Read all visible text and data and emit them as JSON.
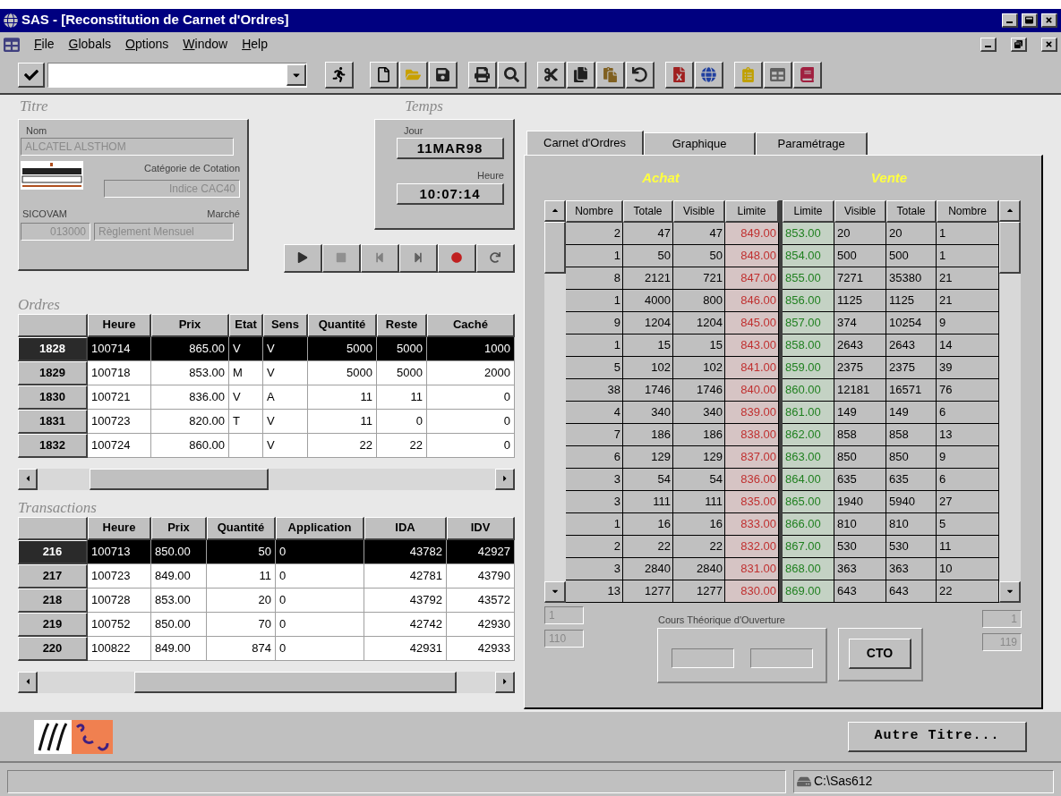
{
  "window": {
    "title": "SAS - [Reconstitution de Carnet d'Ordres]"
  },
  "menu": [
    "File",
    "Globals",
    "Options",
    "Window",
    "Help"
  ],
  "titre": {
    "heading": "Titre",
    "nom_label": "Nom",
    "nom": "ALCATEL ALSTHOM",
    "categorie_label": "Catégorie de Cotation",
    "categorie": "Indice CAC40",
    "sicovam_label": "SICOVAM",
    "sicovam": "013000",
    "marche_label": "Marché",
    "marche": "Règlement Mensuel"
  },
  "temps": {
    "heading": "Temps",
    "jour_label": "Jour",
    "jour": "11MAR98",
    "heure_label": "Heure",
    "heure": "10:07:14"
  },
  "ordres": {
    "heading": "Ordres",
    "columns": [
      "Heure",
      "Prix",
      "Etat",
      "Sens",
      "Quantité",
      "Reste",
      "Caché"
    ],
    "rows": [
      {
        "id": "1828",
        "heure": "100714",
        "prix": "865.00",
        "etat": "V",
        "sens": "V",
        "quantite": "5000",
        "reste": "5000",
        "cache": "1000",
        "selected": true
      },
      {
        "id": "1829",
        "heure": "100718",
        "prix": "853.00",
        "etat": "M",
        "sens": "V",
        "quantite": "5000",
        "reste": "5000",
        "cache": "2000",
        "selected": false
      },
      {
        "id": "1830",
        "heure": "100721",
        "prix": "836.00",
        "etat": "V",
        "sens": "A",
        "quantite": "11",
        "reste": "11",
        "cache": "0",
        "selected": false
      },
      {
        "id": "1831",
        "heure": "100723",
        "prix": "820.00",
        "etat": "T",
        "sens": "V",
        "quantite": "11",
        "reste": "0",
        "cache": "0",
        "selected": false
      },
      {
        "id": "1832",
        "heure": "100724",
        "prix": "860.00",
        "sens": "V",
        "quantite": "22",
        "reste": "22",
        "cache": "0",
        "selected": false
      }
    ]
  },
  "transactions": {
    "heading": "Transactions",
    "columns": [
      "Heure",
      "Prix",
      "Quantité",
      "Application",
      "IDA",
      "IDV"
    ],
    "rows": [
      {
        "id": "216",
        "heure": "100713",
        "prix": "850.00",
        "quantite": "50",
        "application": "0",
        "ida": "43782",
        "idv": "42927",
        "selected": true
      },
      {
        "id": "217",
        "heure": "100723",
        "prix": "849.00",
        "quantite": "11",
        "application": "0",
        "ida": "42781",
        "idv": "43790",
        "selected": false
      },
      {
        "id": "218",
        "heure": "100728",
        "prix": "853.00",
        "quantite": "20",
        "application": "0",
        "ida": "43792",
        "idv": "43572",
        "selected": false
      },
      {
        "id": "219",
        "heure": "100752",
        "prix": "850.00",
        "quantite": "70",
        "application": "0",
        "ida": "42742",
        "idv": "42930",
        "selected": false
      },
      {
        "id": "220",
        "heure": "100822",
        "prix": "849.00",
        "quantite": "874",
        "application": "0",
        "ida": "42931",
        "idv": "42933",
        "selected": false
      }
    ]
  },
  "carnet": {
    "tabs": [
      {
        "label": "Carnet d'Ordres",
        "selected": true
      },
      {
        "label": "Graphique",
        "selected": false
      },
      {
        "label": "Paramétrage",
        "selected": false
      }
    ],
    "achat_title": "Achat",
    "vente_title": "Vente",
    "achat_columns": [
      "Nombre",
      "Totale",
      "Visible",
      "Limite"
    ],
    "vente_columns": [
      "Limite",
      "Visible",
      "Totale",
      "Nombre"
    ],
    "rows": [
      {
        "achat": [
          "2",
          "47",
          "47",
          "849.00"
        ],
        "vente": [
          "853.00",
          "20",
          "20",
          "1"
        ]
      },
      {
        "achat": [
          "1",
          "50",
          "50",
          "848.00"
        ],
        "vente": [
          "854.00",
          "500",
          "500",
          "1"
        ]
      },
      {
        "achat": [
          "8",
          "2121",
          "721",
          "847.00"
        ],
        "vente": [
          "855.00",
          "7271",
          "35380",
          "21"
        ]
      },
      {
        "achat": [
          "1",
          "4000",
          "800",
          "846.00"
        ],
        "vente": [
          "856.00",
          "1125",
          "1125",
          "21"
        ]
      },
      {
        "achat": [
          "9",
          "1204",
          "1204",
          "845.00"
        ],
        "vente": [
          "857.00",
          "374",
          "10254",
          "9"
        ]
      },
      {
        "achat": [
          "1",
          "15",
          "15",
          "843.00"
        ],
        "vente": [
          "858.00",
          "2643",
          "2643",
          "14"
        ]
      },
      {
        "achat": [
          "5",
          "102",
          "102",
          "841.00"
        ],
        "vente": [
          "859.00",
          "2375",
          "2375",
          "39"
        ]
      },
      {
        "achat": [
          "38",
          "1746",
          "1746",
          "840.00"
        ],
        "vente": [
          "860.00",
          "12181",
          "16571",
          "76"
        ]
      },
      {
        "achat": [
          "4",
          "340",
          "340",
          "839.00"
        ],
        "vente": [
          "861.00",
          "149",
          "149",
          "6"
        ]
      },
      {
        "achat": [
          "7",
          "186",
          "186",
          "838.00"
        ],
        "vente": [
          "862.00",
          "858",
          "858",
          "13"
        ]
      },
      {
        "achat": [
          "6",
          "129",
          "129",
          "837.00"
        ],
        "vente": [
          "863.00",
          "850",
          "850",
          "9"
        ]
      },
      {
        "achat": [
          "3",
          "54",
          "54",
          "836.00"
        ],
        "vente": [
          "864.00",
          "635",
          "635",
          "6"
        ]
      },
      {
        "achat": [
          "3",
          "111",
          "111",
          "835.00"
        ],
        "vente": [
          "865.00",
          "1940",
          "5940",
          "27"
        ]
      },
      {
        "achat": [
          "1",
          "16",
          "16",
          "833.00"
        ],
        "vente": [
          "866.00",
          "810",
          "810",
          "5"
        ]
      },
      {
        "achat": [
          "2",
          "22",
          "22",
          "832.00"
        ],
        "vente": [
          "867.00",
          "530",
          "530",
          "11"
        ]
      },
      {
        "achat": [
          "3",
          "2840",
          "2840",
          "831.00"
        ],
        "vente": [
          "868.00",
          "363",
          "363",
          "10"
        ]
      },
      {
        "achat": [
          "13",
          "1277",
          "1277",
          "830.00"
        ],
        "vente": [
          "869.00",
          "643",
          "643",
          "22"
        ]
      }
    ],
    "left_fields": [
      "1",
      "110"
    ],
    "right_fields": [
      "1",
      "119"
    ],
    "cto_label": "Cours Théorique d'Ouverture",
    "cto_button": "CTO"
  },
  "footer": {
    "button": "Autre Titre..."
  },
  "status_bar": {
    "path": "C:\\Sas612"
  }
}
